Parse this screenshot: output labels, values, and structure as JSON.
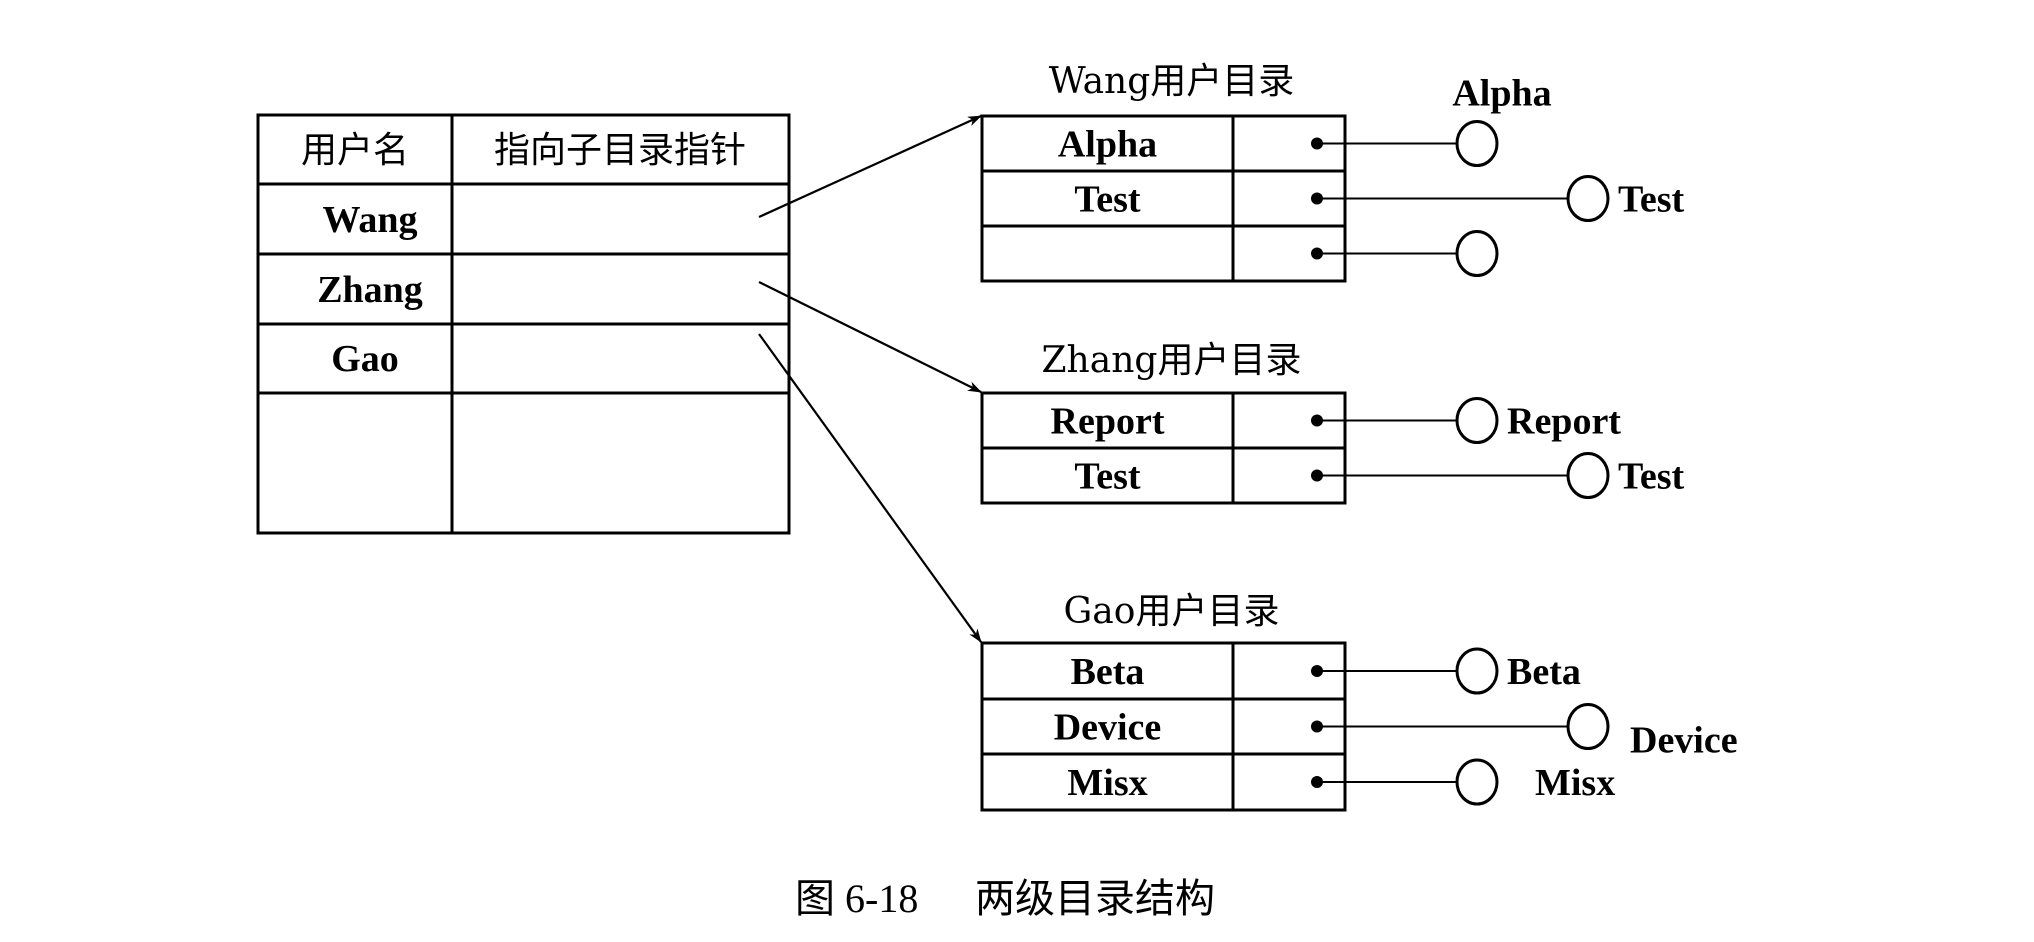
{
  "figure": {
    "caption_number": "图 6-18",
    "caption_title": "两级目录结构"
  },
  "master_directory": {
    "headers": [
      "用户名",
      "指向子目录指针"
    ],
    "rows": [
      {
        "user": "Wang",
        "points_to": "Wang用户目录"
      },
      {
        "user": "Zhang",
        "points_to": "Zhang用户目录"
      },
      {
        "user": "Gao",
        "points_to": "Gao用户目录"
      },
      {
        "user": "",
        "points_to": ""
      }
    ]
  },
  "user_directories": [
    {
      "title": "Wang用户目录",
      "entries": [
        {
          "name": "Alpha",
          "file_label": "Alpha",
          "link": "short",
          "label_pos": "above"
        },
        {
          "name": "Test",
          "file_label": "Test",
          "link": "long",
          "label_pos": "right"
        },
        {
          "name": "",
          "file_label": "",
          "link": "short",
          "label_pos": "none"
        }
      ]
    },
    {
      "title": "Zhang用户目录",
      "entries": [
        {
          "name": "Report",
          "file_label": "Report",
          "link": "short",
          "label_pos": "right"
        },
        {
          "name": "Test",
          "file_label": "Test",
          "link": "long",
          "label_pos": "right"
        }
      ]
    },
    {
      "title": "Gao用户目录",
      "entries": [
        {
          "name": "Beta",
          "file_label": "Beta",
          "link": "short",
          "label_pos": "right"
        },
        {
          "name": "Device",
          "file_label": "Device",
          "link": "long",
          "label_pos": "below-right"
        },
        {
          "name": "Misx",
          "file_label": "Misx",
          "link": "short",
          "label_pos": "right-gap"
        }
      ]
    }
  ]
}
